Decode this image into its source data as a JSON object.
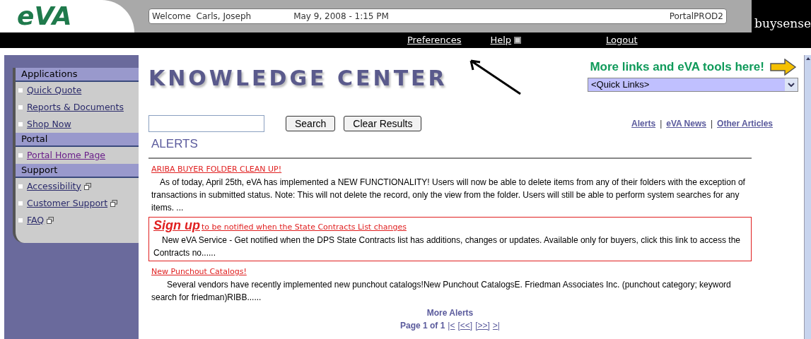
{
  "header": {
    "logo": "eVA",
    "welcome": "Welcome  Carls, Joseph",
    "datetime": "May 9, 2008 - 1:15 PM",
    "environment": "PortalPROD2",
    "brand": "buysense"
  },
  "nav": [
    {
      "label": "Preferences",
      "popup": false
    },
    {
      "label": "Help",
      "popup": true
    },
    {
      "label": "Logout",
      "popup": false
    }
  ],
  "sidebar": [
    {
      "heading": "Applications",
      "items": [
        {
          "label": "Quick Quote",
          "popup": false,
          "visited": false
        },
        {
          "label": "Reports & Documents",
          "popup": false,
          "visited": false
        },
        {
          "label": "Shop Now",
          "popup": false,
          "visited": false
        }
      ]
    },
    {
      "heading": "Portal",
      "items": [
        {
          "label": "Portal Home Page",
          "popup": false,
          "visited": true
        }
      ]
    },
    {
      "heading": "Support",
      "items": [
        {
          "label": "Accessibility",
          "popup": true,
          "visited": false
        },
        {
          "label": "Customer Support",
          "popup": true,
          "visited": false
        },
        {
          "label": "FAQ",
          "popup": true,
          "visited": false
        }
      ]
    }
  ],
  "title": "KNOWLEDGE CENTER",
  "promo": "More links and eVA tools here!",
  "quick_links": {
    "value": "<Quick Links>"
  },
  "search": {
    "buttons": [
      "Search",
      "Clear Results"
    ]
  },
  "section_links": [
    "Alerts",
    "eVA News",
    "Other Articles"
  ],
  "section_separator": "|",
  "section_title": "ALERTS",
  "alerts": [
    {
      "kind": "plain",
      "title": "ARIBA BUYER FOLDER CLEAN UP!",
      "body": "As of today, April 25th, eVA has implemented a NEW  FUNCTIONALITY! Users will now be able to delete items from any of their folders with the exception of transactions in submitted status. Note: This will not delete the record, only the view from the folder. Users will still be able to perform system searches for any items. ..."
    },
    {
      "kind": "boxed",
      "lead": "Sign up",
      "title": "to be notified when the State Contracts List changes",
      "body": "New eVA Service - Get notified when the DPS State Contracts list has additions, changes or updates. Available only for buyers, click this link to access the Contracts no......"
    },
    {
      "kind": "plain",
      "title": "New Punchout Catalogs!",
      "body": "Several vendors have recently implemented new punchout catalogs!New Punchout CatalogsE. Friedman Associates Inc. (punchout category; keyword search for friedman)RIBB......"
    }
  ],
  "more": "More Alerts",
  "pager": {
    "label": "Page 1 of 1",
    "links": [
      "|<",
      "[<<]",
      "[>>]",
      ">|"
    ]
  }
}
